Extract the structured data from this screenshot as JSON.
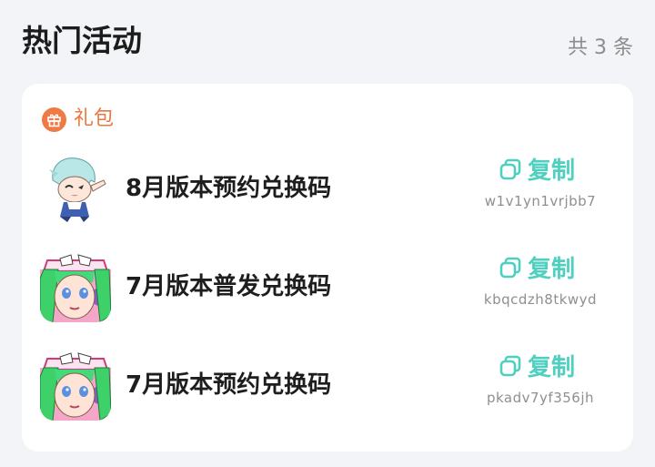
{
  "header": {
    "title": "热门活动",
    "count": "共 3 条"
  },
  "section": {
    "label": "礼包",
    "icon": "gift-icon",
    "color": "#ee7a45"
  },
  "accent_color": "#4ecfc0",
  "items": [
    {
      "title": "8月版本预约兑换码",
      "copy_label": "复制",
      "code": "w1v1yn1vrjbb7",
      "avatar": "chibi-character-avatar"
    },
    {
      "title": "7月版本普发兑换码",
      "copy_label": "复制",
      "code": "kbqcdzh8tkwyd",
      "avatar": "green-hair-character-avatar"
    },
    {
      "title": "7月版本预约兑换码",
      "copy_label": "复制",
      "code": "pkadv7yf356jh",
      "avatar": "green-hair-character-avatar"
    }
  ]
}
